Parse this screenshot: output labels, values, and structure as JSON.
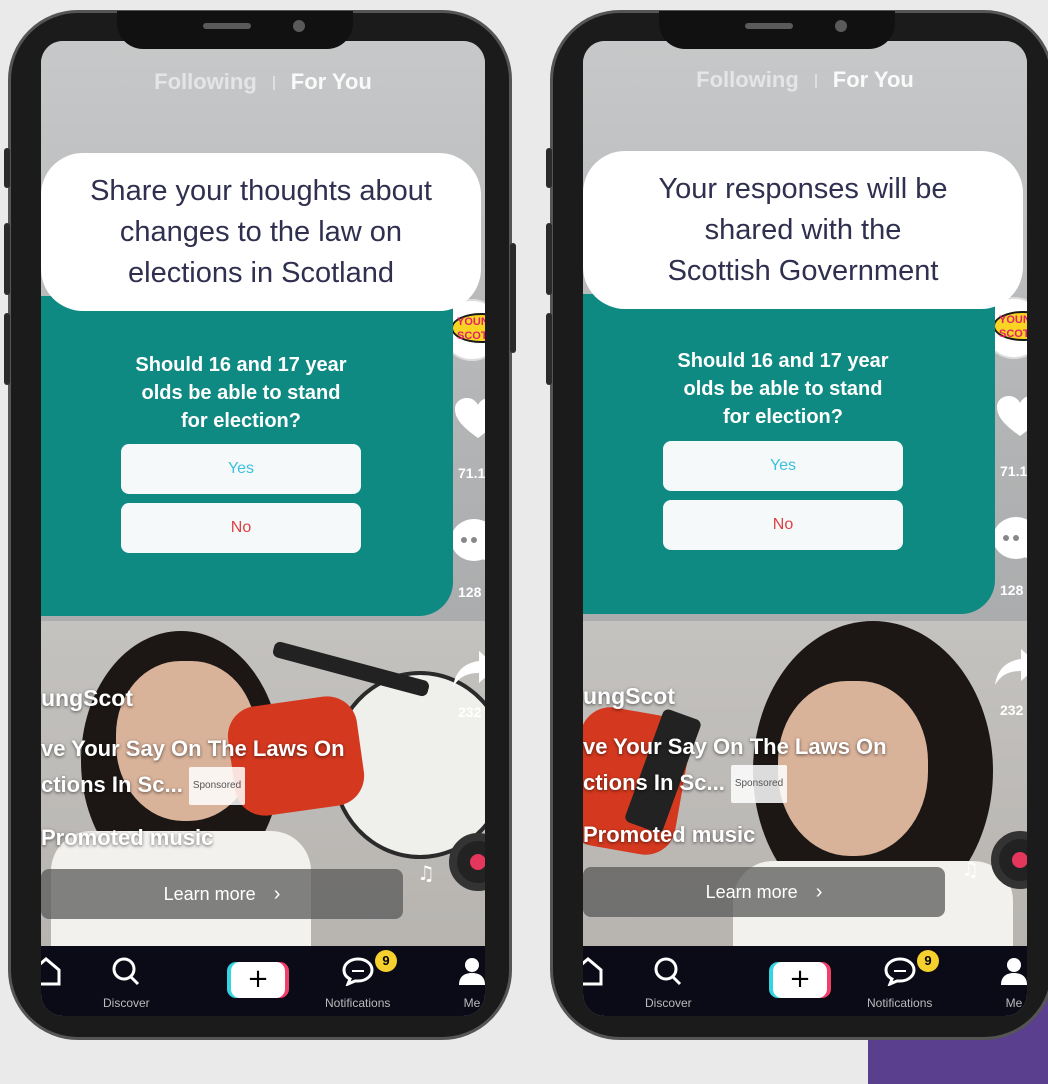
{
  "feed_tabs": {
    "following": "Following",
    "for_you": "For You"
  },
  "phones": [
    {
      "bubble_lines": [
        "Share your thoughts about",
        "changes to the law on",
        "elections in Scotland"
      ],
      "question_lines": [
        "Should 16 and 17 year",
        "olds be able to stand",
        "for election?"
      ],
      "options": {
        "yes": "Yes",
        "no": "No"
      },
      "likes": "71.1",
      "comments": "128",
      "shares": "232",
      "username": "ungScot",
      "desc_line1": "ve Your Say On The Laws On",
      "desc_line2": "ctions In Sc...",
      "sponsored": "Sponsored",
      "music": "Promoted music",
      "learn_more": "Learn more",
      "nav": {
        "discover": "Discover",
        "notifications": "Notifications",
        "me": "Me",
        "badge": "9"
      }
    },
    {
      "bubble_lines": [
        "Your responses will be",
        "shared with the",
        "Scottish Government"
      ],
      "question_lines": [
        "Should 16 and 17 year",
        "olds be able to stand",
        "for election?"
      ],
      "options": {
        "yes": "Yes",
        "no": "No"
      },
      "likes": "71.1",
      "comments": "128",
      "shares": "232",
      "username": "ungScot",
      "desc_line1": "ve Your Say On The Laws On",
      "desc_line2": "ctions In Sc...",
      "sponsored": "Sponsored",
      "music": "Promoted music",
      "learn_more": "Learn more",
      "nav": {
        "discover": "Discover",
        "notifications": "Notifications",
        "me": "Me",
        "badge": "9"
      }
    }
  ],
  "avatar_logo": "YOUNG SCOT",
  "colors": {
    "poll_teal": "#0f8a83",
    "yes_text": "#3cc0dc",
    "no_text": "#e0403f",
    "nav_bg": "#0b0b18",
    "badge": "#f6d02c",
    "bubble_text": "#2f2f4f"
  },
  "icons": [
    "home-icon",
    "search-icon",
    "plus-icon",
    "chat-icon",
    "profile-icon",
    "heart-icon",
    "comment-icon",
    "share-icon",
    "music-note-icon",
    "music-disc-icon",
    "chevron-right-icon"
  ]
}
